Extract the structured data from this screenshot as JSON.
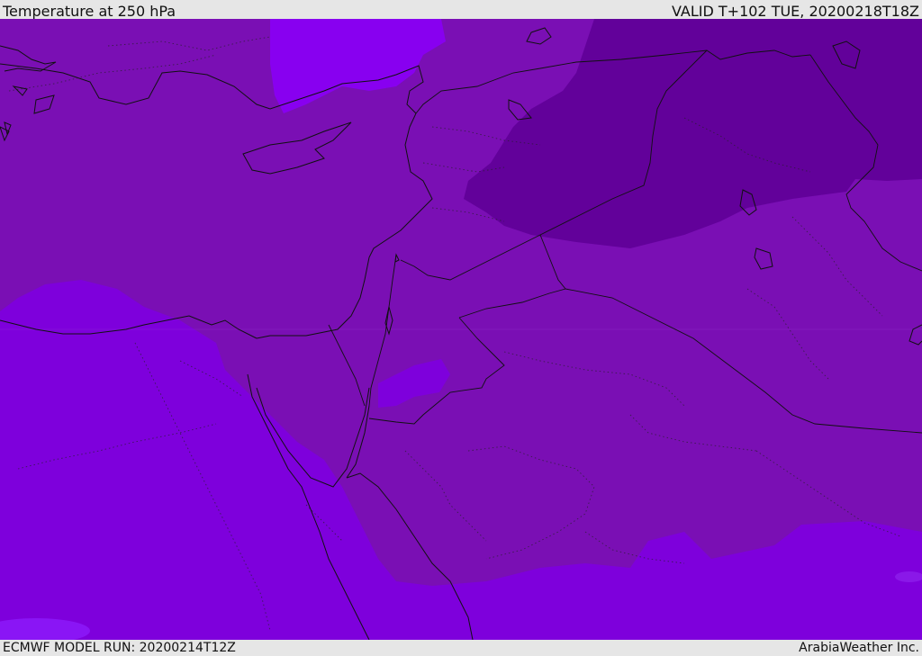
{
  "header": {
    "title": "Temperature at 250 hPa",
    "valid": "VALID T+102 TUE, 20200218T18Z"
  },
  "footer": {
    "model_run": "ECMWF MODEL RUN: 20200214T12Z",
    "credit": "ArabiaWeather Inc."
  },
  "map": {
    "colors": {
      "warmest": "#7e00dc",
      "light": "#8800f0",
      "mid": "#7a0fb4",
      "dark": "#62019a",
      "coast": "#111111"
    }
  }
}
